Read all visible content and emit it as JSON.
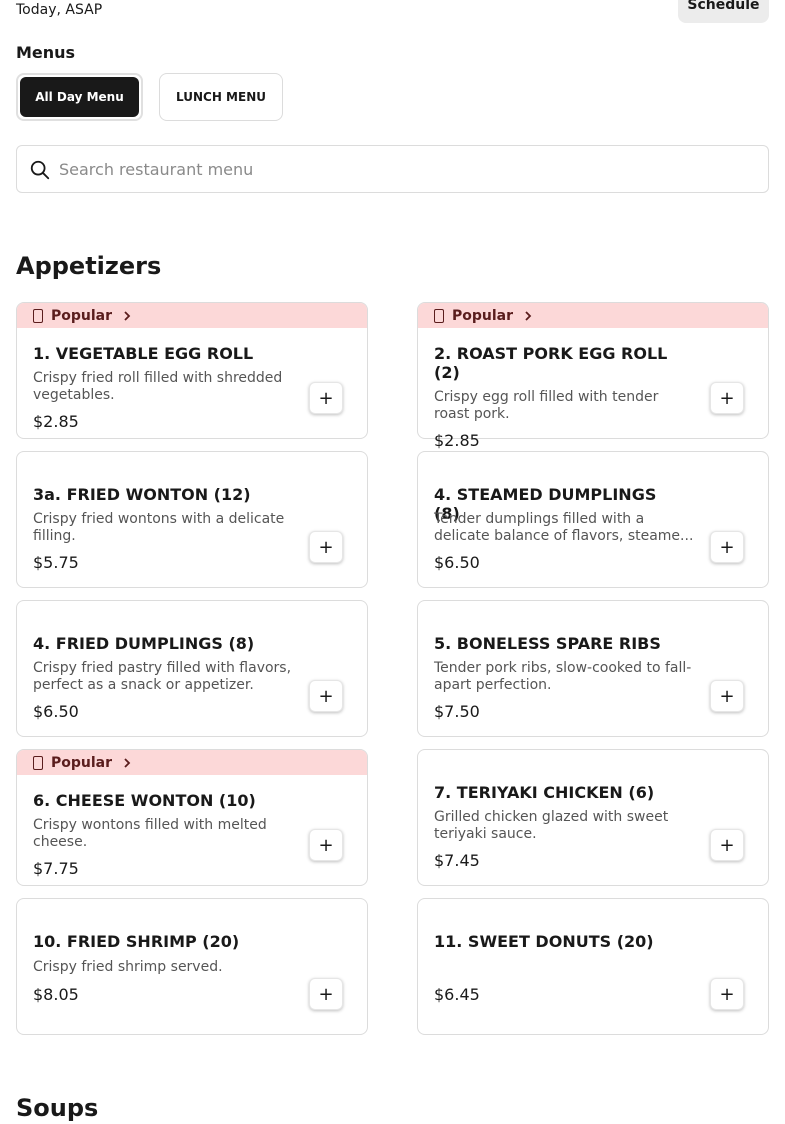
{
  "header": {
    "time_text": "Today, ASAP",
    "schedule_label": "Schedule"
  },
  "menus": {
    "label": "Menus",
    "tabs": [
      {
        "label": "All Day Menu",
        "selected": true
      },
      {
        "label": "LUNCH MENU",
        "selected": false
      }
    ]
  },
  "search": {
    "placeholder": "Search restaurant menu",
    "value": ""
  },
  "sections": [
    {
      "title": "Appetizers",
      "popular_label": "Popular",
      "items": [
        {
          "name": "1. VEGETABLE EGG ROLL",
          "description": "Crispy fried roll filled with shredded vegetables.",
          "price": "$2.85",
          "popular": true
        },
        {
          "name": "2. ROAST PORK EGG ROLL (2)",
          "description": "Crispy egg roll filled with tender roast pork.",
          "price": "$2.85",
          "popular": true
        },
        {
          "name": "3a. FRIED WONTON (12)",
          "description": "Crispy fried wontons with a delicate filling.",
          "price": "$5.75",
          "popular": false
        },
        {
          "name": "4. STEAMED DUMPLINGS (8)",
          "description": "Tender dumplings filled with a delicate balance of flavors, steame...",
          "price": "$6.50",
          "popular": false
        },
        {
          "name": "4. FRIED DUMPLINGS (8)",
          "description": "Crispy fried pastry filled with flavors, perfect as a snack or appetizer.",
          "price": "$6.50",
          "popular": false
        },
        {
          "name": "5. BONELESS SPARE RIBS",
          "description": "Tender pork ribs, slow-cooked to fall-apart perfection.",
          "price": "$7.50",
          "popular": false
        },
        {
          "name": "6. CHEESE WONTON (10)",
          "description": "Crispy wontons filled with melted cheese.",
          "price": "$7.75",
          "popular": true
        },
        {
          "name": "7. TERIYAKI CHICKEN (6)",
          "description": "Grilled chicken glazed with sweet teriyaki sauce.",
          "price": "$7.45",
          "popular": false
        },
        {
          "name": "10. FRIED SHRIMP (20)",
          "description": "Crispy fried shrimp served.",
          "price": "$8.05",
          "popular": false
        },
        {
          "name": "11. SWEET DONUTS (20)",
          "description": "",
          "price": "$6.45",
          "popular": false
        }
      ]
    },
    {
      "title": "Soups"
    }
  ],
  "icons": {
    "add": "+",
    "search": "search-icon",
    "popular": "popular-icon",
    "chevron": "chevron-right-icon"
  },
  "colors": {
    "popular_bg": "#fcd8d8",
    "active_tab_bg": "#191919",
    "schedule_bg": "#ececec"
  }
}
